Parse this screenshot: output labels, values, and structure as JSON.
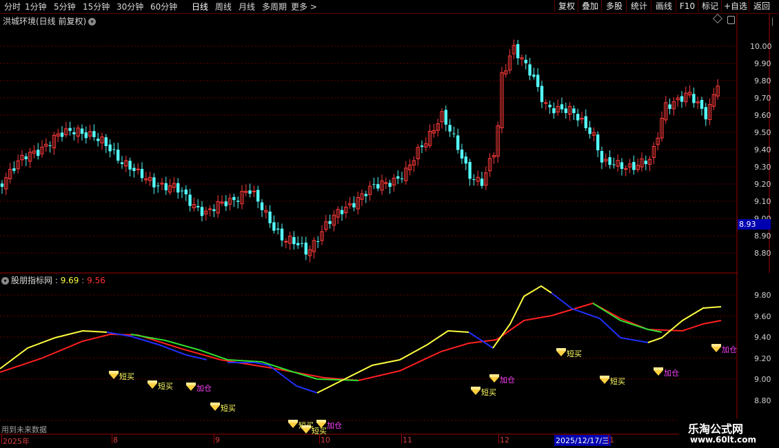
{
  "toolbar": {
    "periods": [
      "分时",
      "1分钟",
      "5分钟",
      "15分钟",
      "30分钟",
      "60分钟",
      "日线",
      "周线",
      "月线",
      "多周期"
    ],
    "active_period": "日线",
    "more_label": "更多 >",
    "tools": [
      "复权",
      "叠加",
      "多股",
      "统计",
      "画线",
      "F10",
      "标记",
      "+自选",
      "返回"
    ]
  },
  "main_chart": {
    "title": "洪城环境(日线 前复权)",
    "price_axis": [
      "10.00",
      "9.90",
      "9.80",
      "9.70",
      "9.60",
      "9.50",
      "9.40",
      "9.30",
      "9.20",
      "9.10",
      "9.00",
      "8.90",
      "8.80"
    ],
    "current_price_tag": "8.93"
  },
  "indicator": {
    "name": "股朋指标网",
    "separator": ":",
    "value1": "9.69",
    "value2": "9.56",
    "axis": [
      "9.80",
      "9.60",
      "9.40",
      "9.20",
      "9.00",
      "8.80"
    ],
    "signals": [
      "短买",
      "短买",
      "加仓",
      "短买",
      "短买",
      "短买",
      "加仓",
      "短买",
      "加仓",
      "短买",
      "短买",
      "加仓",
      "加仓"
    ],
    "footer_note": "用到未来数据"
  },
  "date_axis": {
    "labels": [
      "2025年",
      "8",
      "9",
      "10",
      "11",
      "12",
      "1"
    ],
    "cursor_date": "2025/12/17/三"
  },
  "watermark": {
    "brand": "乐淘公式网",
    "url": "www.60lt.com"
  },
  "colors": {
    "up": "#ff3b3b",
    "down": "#54ffff",
    "line_yellow": "#ffff40",
    "line_red": "#ff2020",
    "line_blue": "#2030ff",
    "line_green": "#30e030",
    "accent_blue": "#0000b0"
  }
}
